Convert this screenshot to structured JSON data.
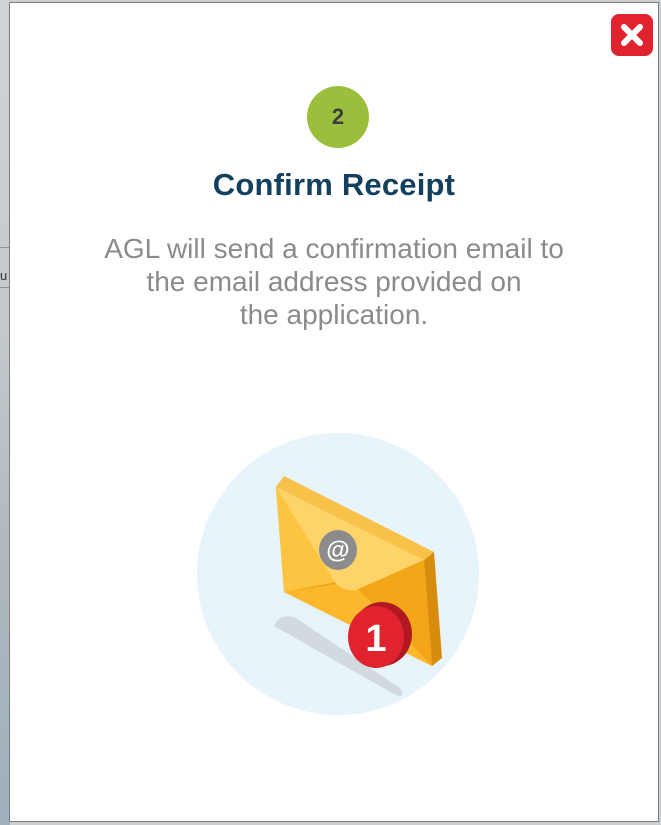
{
  "modal": {
    "step_number": "2",
    "title": "Confirm Receipt",
    "description_lines": [
      "AGL will send a confirmation email to",
      "the email address provided on",
      "the application."
    ],
    "close_icon": "close-x-icon",
    "illustration": {
      "icon": "email-envelope-icon",
      "at_symbol": "@",
      "notification_count": "1"
    }
  },
  "backdrop": {
    "partial_text": "u"
  },
  "colors": {
    "title": "#14405f",
    "step_badge": "#9bbf3c",
    "close_button": "#e0232f",
    "description": "#8b8b8b",
    "envelope": "#f9b51f",
    "notification": "#e0232f",
    "circle_bg": "#e7f4fa"
  }
}
